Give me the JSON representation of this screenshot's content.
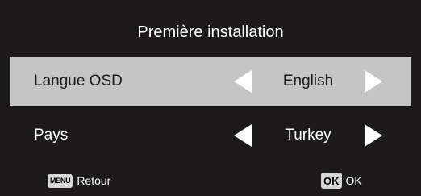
{
  "title": "Première installation",
  "rows": [
    {
      "label": "Langue OSD",
      "value": "English",
      "selected": true
    },
    {
      "label": "Pays",
      "value": "Turkey",
      "selected": false
    }
  ],
  "footer": {
    "menu_key": "MENU",
    "menu_action": "Retour",
    "ok_key": "OK",
    "ok_action": "OK"
  },
  "colors": {
    "background": "#1c1a1a",
    "selected_row": "#c5c5c5",
    "text_light": "#ffffff",
    "text_dark": "#1a1a1a"
  },
  "icons": {
    "left_arrow": "triangle-left-icon",
    "right_arrow": "triangle-right-icon"
  }
}
